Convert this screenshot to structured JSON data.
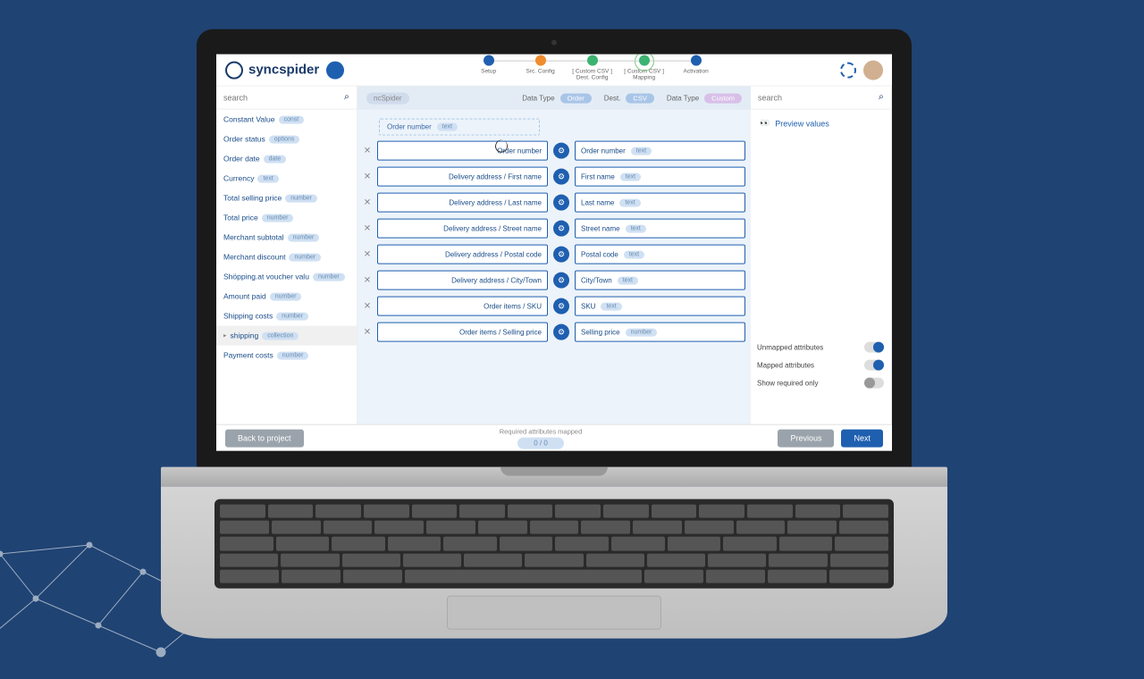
{
  "brand": "syncspider",
  "stepper": [
    {
      "label": "Setup",
      "color": "#1f5fb0"
    },
    {
      "label": "Src. Config",
      "color": "#f08c2e"
    },
    {
      "label": "[ Custom CSV ]\nDest. Config",
      "color": "#3cb371"
    },
    {
      "label": "[ Custom CSV ]\nMapping",
      "color": "#3cb371",
      "current": true
    },
    {
      "label": "Activation",
      "color": "#1f5fb0"
    }
  ],
  "left": {
    "search_placeholder": "search",
    "attributes": [
      {
        "name": "Constant Value",
        "type": "const"
      },
      {
        "name": "Order status",
        "type": "options"
      },
      {
        "name": "Order date",
        "type": "date"
      },
      {
        "name": "Currency",
        "type": "text"
      },
      {
        "name": "Total selling price",
        "type": "number"
      },
      {
        "name": "Total price",
        "type": "number"
      },
      {
        "name": "Merchant subtotal",
        "type": "number"
      },
      {
        "name": "Merchant discount",
        "type": "number"
      },
      {
        "name": "Shöpping.at voucher valu",
        "type": "number"
      },
      {
        "name": "Amount paid",
        "type": "number"
      },
      {
        "name": "Shipping costs",
        "type": "number"
      },
      {
        "name": "shipping",
        "type": "collection",
        "expand": true
      },
      {
        "name": "Payment costs",
        "type": "number"
      }
    ]
  },
  "mid": {
    "src_app": "ncSpider",
    "data_type_label": "Data Type",
    "data_type_value": "Order",
    "dest_label": "Dest.",
    "dest_value": "CSV",
    "dest_data_type_label": "Data Type",
    "dest_data_type_value": "Custom",
    "drag_hint": {
      "label": "Order number",
      "type": "text"
    },
    "rows": [
      {
        "src": "Order number",
        "dst": "Order number",
        "dtype": "text"
      },
      {
        "src": "Delivery address / First name",
        "dst": "First name",
        "dtype": "text"
      },
      {
        "src": "Delivery address / Last name",
        "dst": "Last name",
        "dtype": "text"
      },
      {
        "src": "Delivery address / Street name",
        "dst": "Street name",
        "dtype": "text"
      },
      {
        "src": "Delivery address / Postal code",
        "dst": "Postal code",
        "dtype": "text"
      },
      {
        "src": "Delivery address / City/Town",
        "dst": "City/Town",
        "dtype": "text"
      },
      {
        "src": "Order items / SKU",
        "dst": "SKU",
        "dtype": "text"
      },
      {
        "src": "Order items / Selling price",
        "dst": "Selling price",
        "dtype": "number"
      }
    ]
  },
  "right": {
    "search_placeholder": "search",
    "preview": "Preview values",
    "toggles": [
      {
        "label": "Unmapped attributes",
        "on": true
      },
      {
        "label": "Mapped attributes",
        "on": true
      },
      {
        "label": "Show required only",
        "on": false
      }
    ]
  },
  "footer": {
    "back": "Back to project",
    "progress_label": "Required attributes mapped",
    "progress_value": "0 / 0",
    "prev": "Previous",
    "next": "Next"
  }
}
